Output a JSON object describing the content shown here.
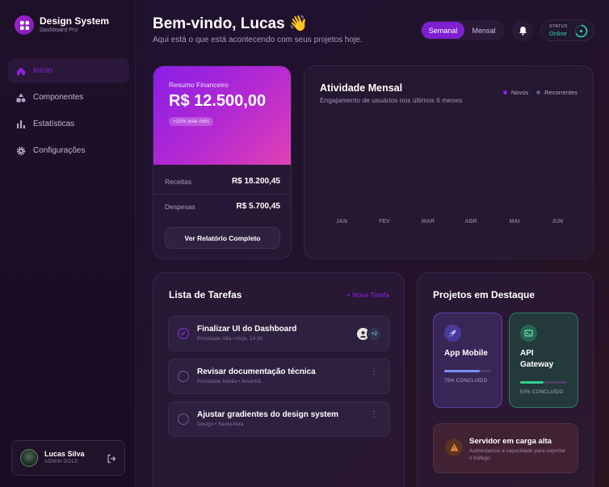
{
  "brand": {
    "title": "Design System",
    "subtitle": "Dashboard Pro"
  },
  "nav": [
    {
      "label": "Início",
      "icon": "home-icon",
      "active": true
    },
    {
      "label": "Componentes",
      "icon": "shapes-icon"
    },
    {
      "label": "Estatísticas",
      "icon": "bar-chart-icon"
    },
    {
      "label": "Configurações",
      "icon": "gear-icon"
    }
  ],
  "user": {
    "name": "Lucas Silva",
    "role": "ADMIN GOLD"
  },
  "header": {
    "greeting": "Bem-vindo, Lucas 👋",
    "subtitle": "Aqui está o que está acontecendo com seus projetos hoje.",
    "toggle": {
      "active": "Semanal",
      "inactive": "Mensal"
    },
    "status_label": "STATUS",
    "status_value": "Online"
  },
  "finance": {
    "label": "Resumo Financeiro",
    "amount": "R$ 12.500,00",
    "badge": "+15% este mês",
    "income_label": "Receitas",
    "income_value": "R$ 18.200,45",
    "expense_label": "Despesas",
    "expense_value": "R$ 5.700,45",
    "button": "Ver Relatório Completo"
  },
  "activity": {
    "title": "Atividade Mensal",
    "subtitle": "Engajamento de usuários nos últimos 6 meses",
    "legend": [
      {
        "name": "Novos",
        "color": "#8a22e0"
      },
      {
        "name": "Recorrentes",
        "color": "#4f5f8a"
      }
    ],
    "months": [
      "JAN",
      "FEV",
      "MAR",
      "ABR",
      "MAI",
      "JUN"
    ]
  },
  "tasks": {
    "title": "Lista de Tarefas",
    "new_button": "+ Nova Tarefa",
    "items": [
      {
        "name": "Finalizar UI do Dashboard",
        "meta": "Prioridade Alta • Hoje, 14:30",
        "done": true,
        "extra": "+2"
      },
      {
        "name": "Revisar documentação técnica",
        "meta": "Prioridade Média • Amanhã",
        "done": false
      },
      {
        "name": "Ajustar gradientes do design system",
        "meta": "Design • Sexta-feira",
        "done": false
      }
    ]
  },
  "projects": {
    "title": "Projetos em Destaque",
    "items": [
      {
        "name": "App Mobile",
        "progress_text": "75% CONCLUÍDO",
        "progress": 0.75,
        "icon": "rocket-icon"
      },
      {
        "name": "API Gateway",
        "progress_text": "50% CONCLUÍDO",
        "progress": 0.5,
        "icon": "terminal-icon"
      }
    ],
    "alert": {
      "title": "Servidor em carga alta",
      "description": "Aumentamos a capacidade para suportar o tráfego.",
      "icon": "warning-icon"
    }
  }
}
